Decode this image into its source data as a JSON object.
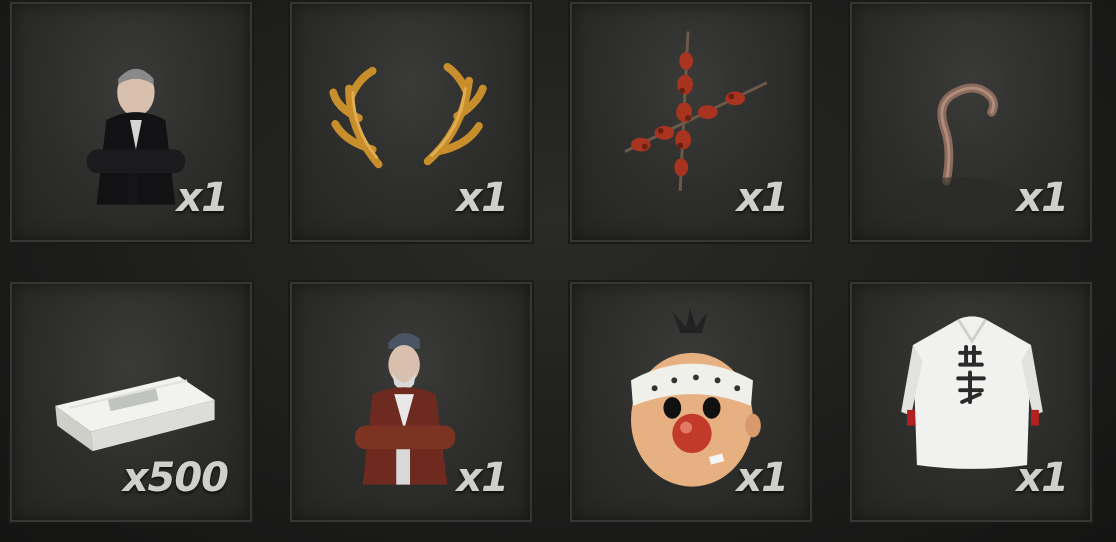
{
  "reward_grid": {
    "items": [
      {
        "name": "man-black-jacket-costume",
        "quantity": "x1"
      },
      {
        "name": "antlers",
        "quantity": "x1"
      },
      {
        "name": "crossed-skewers",
        "quantity": "x1"
      },
      {
        "name": "curled-tail",
        "quantity": "x1"
      },
      {
        "name": "cash-stack",
        "quantity": "x500"
      },
      {
        "name": "old-man-red-jacket-costume",
        "quantity": "x1"
      },
      {
        "name": "clown-mask",
        "quantity": "x1"
      },
      {
        "name": "white-robe",
        "quantity": "x1"
      }
    ]
  }
}
